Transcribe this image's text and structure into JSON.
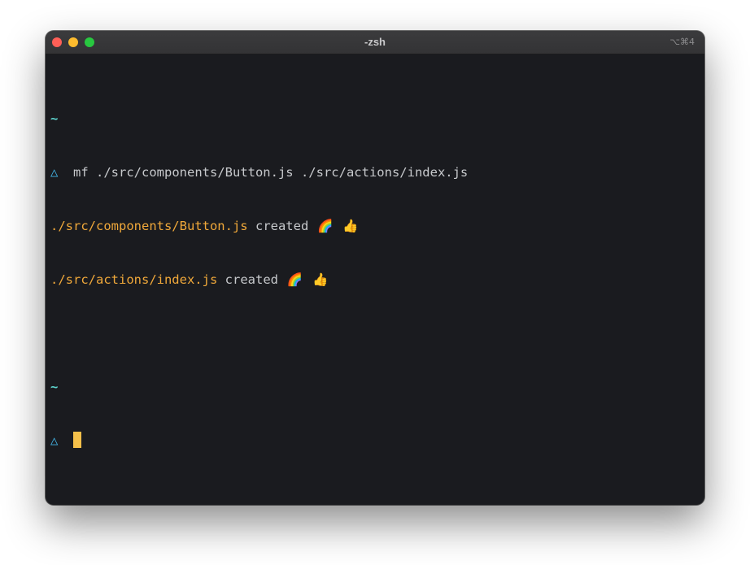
{
  "window": {
    "title": "-zsh",
    "shortcut": "⌥⌘4"
  },
  "terminal": {
    "lines": [
      {
        "text": "~"
      },
      {
        "prompt": "△",
        "command": "mf ./src/components/Button.js ./src/actions/index.js"
      },
      {
        "path": "./src/components/Button.js",
        "status": "created",
        "emoji": [
          "🌈",
          "👍"
        ]
      },
      {
        "path": "./src/actions/index.js",
        "status": "created",
        "emoji": [
          "🌈",
          "👍"
        ]
      },
      {
        "text": ""
      },
      {
        "text": "~"
      },
      {
        "prompt": "△"
      }
    ]
  },
  "colors": {
    "background": "#1a1b1f",
    "tilde": "#5ed6d0",
    "prompt": "#43b4e6",
    "path": "#f0a83a",
    "cursor": "#f5c04a"
  },
  "icons": [
    "close-button",
    "minimize-button",
    "zoom-button",
    "rainbow-emoji",
    "thumbs-up-emoji",
    "text-cursor"
  ]
}
